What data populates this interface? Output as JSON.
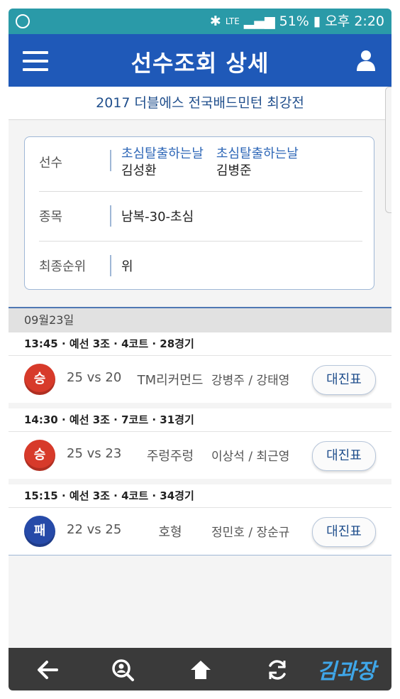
{
  "status_bar": {
    "network": "LTE",
    "battery": "51%",
    "time": "오후 2:20"
  },
  "header": {
    "title": "선수조회 상세"
  },
  "tournament": {
    "name": "2017 더블에스 전국배드민턴 최강전"
  },
  "player_info": {
    "labels": {
      "player": "선수",
      "event": "종목",
      "final_rank": "최종순위"
    },
    "players": [
      {
        "team": "초심탈출하는날",
        "name": "김성환"
      },
      {
        "team": "초심탈출하는날",
        "name": "김병준"
      }
    ],
    "event": "남복-30-초심",
    "final_rank": "위"
  },
  "date": "09월23일",
  "matches": [
    {
      "header": "13:45 · 예선 3조 · 4코트 · 28경기",
      "result": "승",
      "result_type": "win",
      "score": "25 vs 20",
      "opponent_team": "TM리커먼드",
      "opponents": "강병주 / 강태영",
      "button": "대진표"
    },
    {
      "header": "14:30 · 예선 3조 · 7코트 · 31경기",
      "result": "승",
      "result_type": "win",
      "score": "25 vs 23",
      "opponent_team": "주렁주렁",
      "opponents": "이상석 / 최근영",
      "button": "대진표"
    },
    {
      "header": "15:15 · 예선 3조 · 4코트 · 34경기",
      "result": "패",
      "result_type": "loss",
      "score": "22 vs 25",
      "opponent_team": "호형",
      "opponents": "정민호 / 장순규",
      "button": "대진표"
    }
  ],
  "colors": {
    "header": "#1f59b8",
    "status_bar": "#2a9aa8",
    "win": "#d73a2a",
    "loss": "#264aa8",
    "accent_text": "#1f4e8c"
  },
  "nav": {
    "icons": [
      "back-icon",
      "search-user-icon",
      "home-icon",
      "refresh-icon"
    ]
  },
  "watermark": "김과장"
}
